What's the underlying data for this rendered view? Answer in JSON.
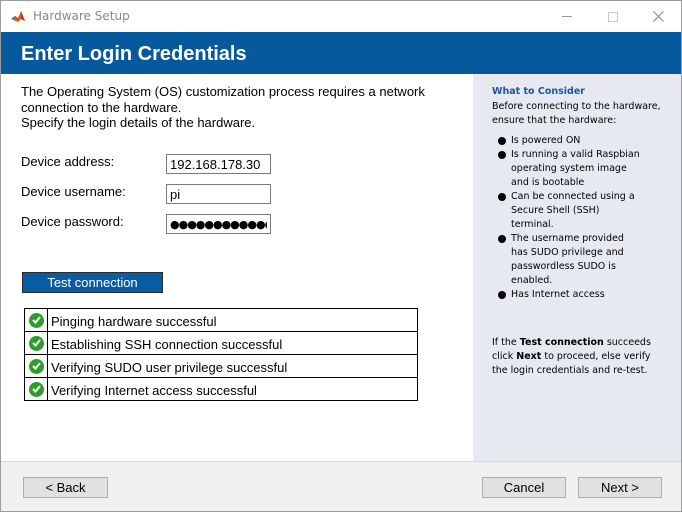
{
  "window": {
    "title": "Hardware Setup"
  },
  "banner": {
    "title": "Enter Login Credentials"
  },
  "main": {
    "intro_line1": "The Operating System (OS) customization process requires a network",
    "intro_line2": "connection to the hardware.",
    "intro_line3": "Specify the login details of the hardware.",
    "fields": {
      "address_label": "Device address:",
      "address_value": "192.168.178.30",
      "username_label": "Device username:",
      "username_value": "pi",
      "password_label": "Device password:",
      "password_value": "●●●●●●●●●●●●●●"
    },
    "test_button_label": "Test connection",
    "results": [
      {
        "text": "Pinging hardware successful",
        "status": "success"
      },
      {
        "text": "Establishing SSH connection successful",
        "status": "success"
      },
      {
        "text": "Verifying SUDO user privilege successful",
        "status": "success"
      },
      {
        "text": "Verifying Internet access successful",
        "status": "success"
      }
    ]
  },
  "side": {
    "heading": "What to Consider",
    "intro_line1": "Before connecting to the hardware,",
    "intro_line2": "ensure that the hardware:",
    "items": [
      [
        "Is powered ON"
      ],
      [
        "Is running a valid Raspbian",
        "operating system image",
        "and is bootable"
      ],
      [
        "Can be connected using a",
        "Secure Shell (SSH)",
        "terminal."
      ],
      [
        "The username provided",
        "has SUDO privilege and",
        "passwordless SUDO is",
        "enabled."
      ],
      [
        "Has Internet access"
      ]
    ],
    "footer": {
      "part1": "If the ",
      "bold1": "Test connection",
      "part2": " succeeds",
      "part3": "click ",
      "bold2": "Next",
      "part4": " to proceed, else verify",
      "part5": "the login credentials and re-test."
    }
  },
  "footer": {
    "back_label": "< Back",
    "cancel_label": "Cancel",
    "next_label": "Next >"
  },
  "colors": {
    "banner": "#06599c",
    "accent_button": "#0a5ca2",
    "success": "#2f9d2d",
    "side_panel": "#e7e9f0",
    "side_heading": "#1a55a6"
  },
  "icons": {
    "app": "matlab-logo-icon",
    "status": "check-circle-icon",
    "bullet": "bullet-dot-icon"
  }
}
